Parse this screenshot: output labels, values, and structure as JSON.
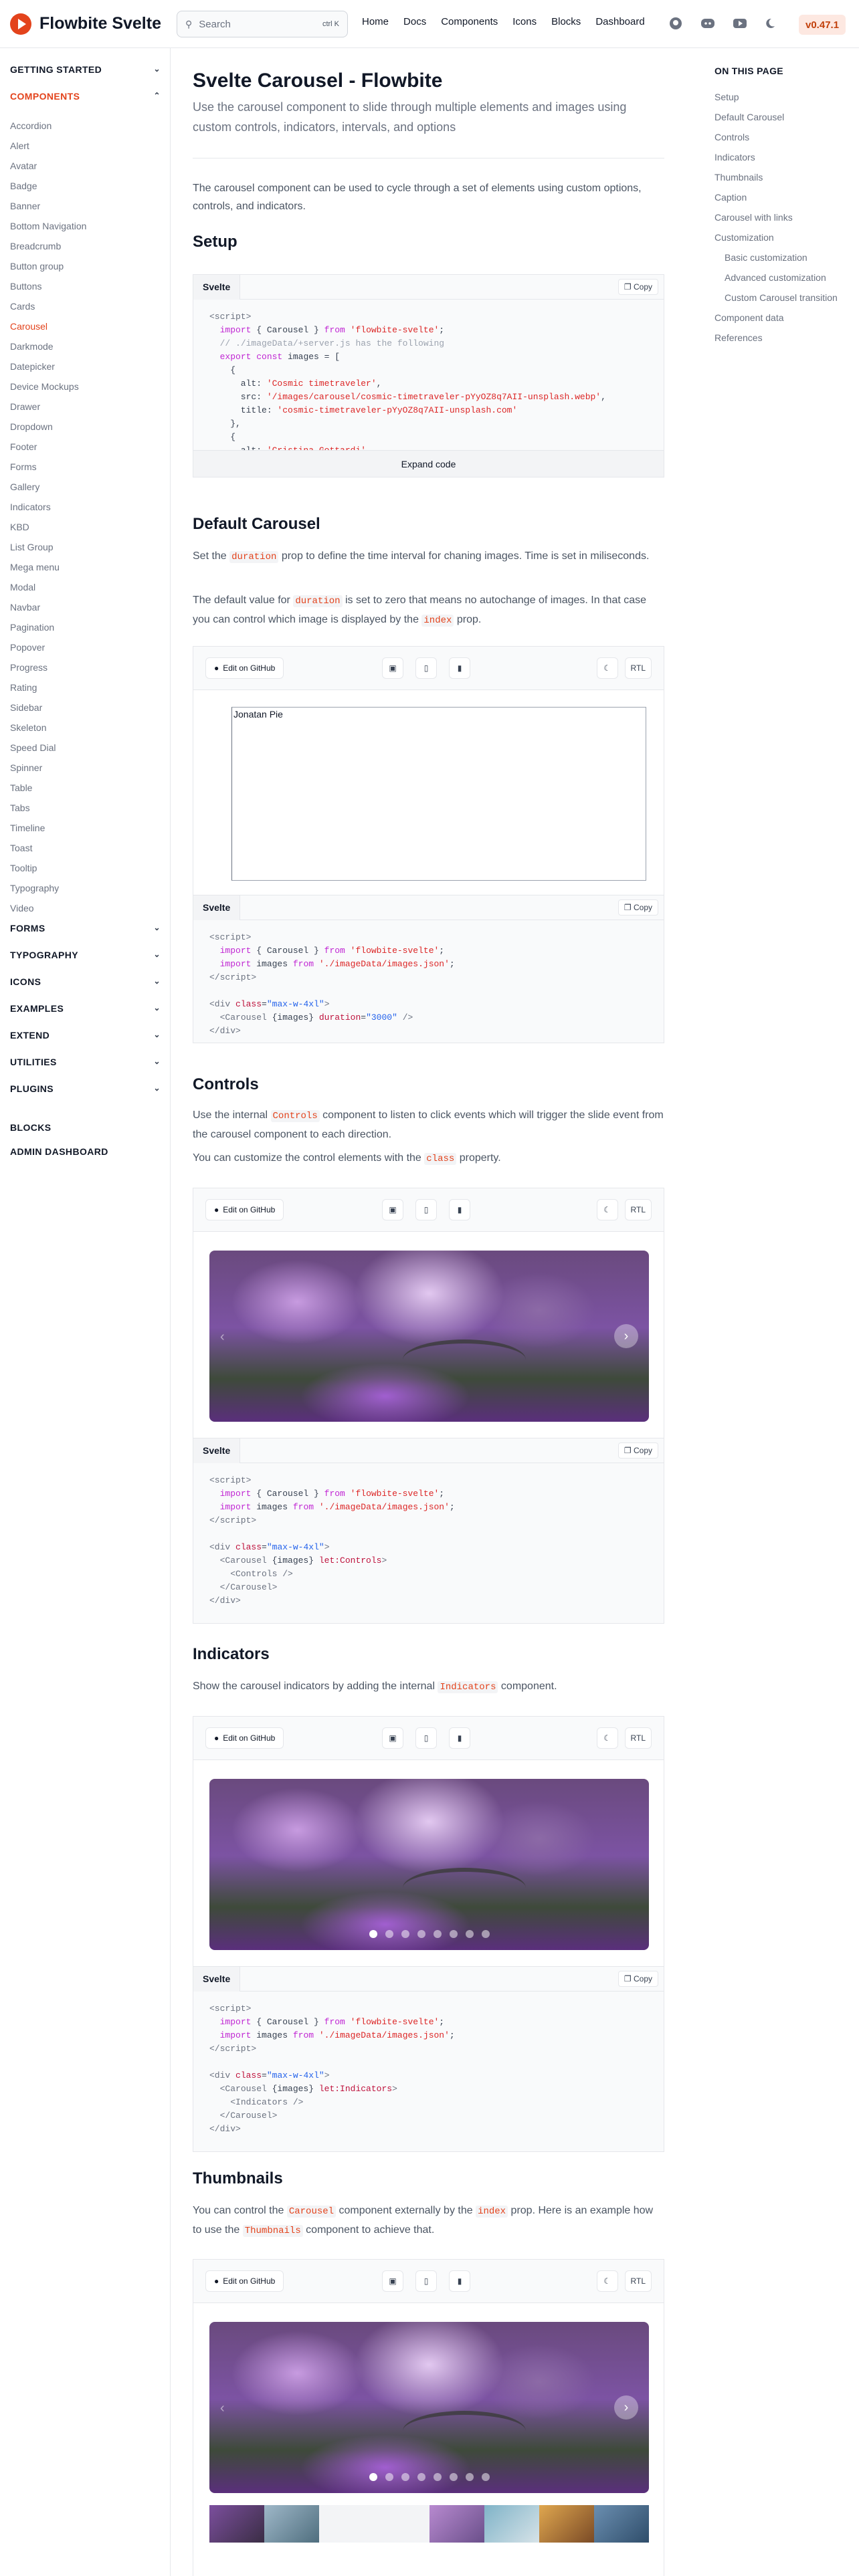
{
  "header": {
    "brand": "Flowbite Svelte",
    "search_placeholder": "Search",
    "search_shortcut": "ctrl K",
    "nav": [
      "Home",
      "Docs",
      "Components",
      "Icons",
      "Blocks",
      "Dashboard"
    ],
    "icons": [
      "github-icon",
      "discord-icon",
      "youtube-icon",
      "moon-icon"
    ],
    "version": "v0.47.1",
    "accent": "#e3431c"
  },
  "sidebar": {
    "sections_top": [
      {
        "label": "GETTING STARTED",
        "active": false
      },
      {
        "label": "COMPONENTS",
        "active": true
      }
    ],
    "items": [
      "Accordion",
      "Alert",
      "Avatar",
      "Badge",
      "Banner",
      "Bottom Navigation",
      "Breadcrumb",
      "Button group",
      "Buttons",
      "Cards",
      "Carousel",
      "Darkmode",
      "Datepicker",
      "Device Mockups",
      "Drawer",
      "Dropdown",
      "Footer",
      "Forms",
      "Gallery",
      "Indicators",
      "KBD",
      "List Group",
      "Mega menu",
      "Modal",
      "Navbar",
      "Pagination",
      "Popover",
      "Progress",
      "Rating",
      "Sidebar",
      "Skeleton",
      "Speed Dial",
      "Spinner",
      "Table",
      "Tabs",
      "Timeline",
      "Toast",
      "Tooltip",
      "Typography",
      "Video"
    ],
    "current": "Carousel",
    "sections_bottom": [
      "FORMS",
      "TYPOGRAPHY",
      "ICONS",
      "EXAMPLES",
      "EXTEND",
      "UTILITIES",
      "PLUGINS"
    ],
    "links_bottom": [
      "BLOCKS",
      "ADMIN DASHBOARD"
    ]
  },
  "page": {
    "title": "Svelte Carousel - Flowbite",
    "lead": "Use the carousel component to slide through multiple elements and images using custom controls, indicators, intervals, and options",
    "intro": "The carousel component can be used to cycle through a set of elements using custom options, controls, and indicators."
  },
  "setup": {
    "heading": "Setup",
    "lang": "Svelte",
    "copy": "Copy",
    "expand": "Expand code"
  },
  "default": {
    "heading": "Default Carousel",
    "p1a": "Set the ",
    "p1code": "duration",
    "p1b": " prop to define the time interval for chaning images. Time is set in miliseconds.",
    "p2a": "The default value for ",
    "p2code": "duration",
    "p2b": " is set to zero that means no autochange of images. In that case you can control which image is displayed by the ",
    "p2code2": "index",
    "p2c": " prop.",
    "image_alt": "Jonatan Pie"
  },
  "controls": {
    "heading": "Controls",
    "p1a": "Use the internal ",
    "p1code": "Controls",
    "p1b": " component to listen to click events which will trigger the slide event from the carousel component to each direction.",
    "p2a": "You can customize the control elements with the ",
    "p2code": "class",
    "p2b": " property."
  },
  "indicators": {
    "heading": "Indicators",
    "pa": "Show the carousel indicators by adding the internal ",
    "pcode": "Indicators",
    "pb": " component."
  },
  "thumbnails": {
    "heading": "Thumbnails",
    "pa": "You can control the ",
    "pcode": "Carousel",
    "pb": " component externally by the ",
    "pcode2": "index",
    "pc": " prop. Here is an example how to use the ",
    "pcode3": "Thumbnails",
    "pd": " component to achieve that."
  },
  "demo": {
    "github": "Edit on GitHub",
    "rtl": "RTL",
    "device_icons": [
      "desktop-icon",
      "tablet-icon",
      "mobile-icon"
    ]
  },
  "toc": {
    "title": "ON THIS PAGE",
    "items": [
      {
        "label": "Setup",
        "sub": false
      },
      {
        "label": "Default Carousel",
        "sub": false
      },
      {
        "label": "Controls",
        "sub": false
      },
      {
        "label": "Indicators",
        "sub": false
      },
      {
        "label": "Thumbnails",
        "sub": false
      },
      {
        "label": "Caption",
        "sub": false
      },
      {
        "label": "Carousel with links",
        "sub": false
      },
      {
        "label": "Customization",
        "sub": false
      },
      {
        "label": "Basic customization",
        "sub": true
      },
      {
        "label": "Advanced customization",
        "sub": true
      },
      {
        "label": "Custom Carousel transition",
        "sub": true
      },
      {
        "label": "Component data",
        "sub": false
      },
      {
        "label": "References",
        "sub": false
      }
    ]
  }
}
